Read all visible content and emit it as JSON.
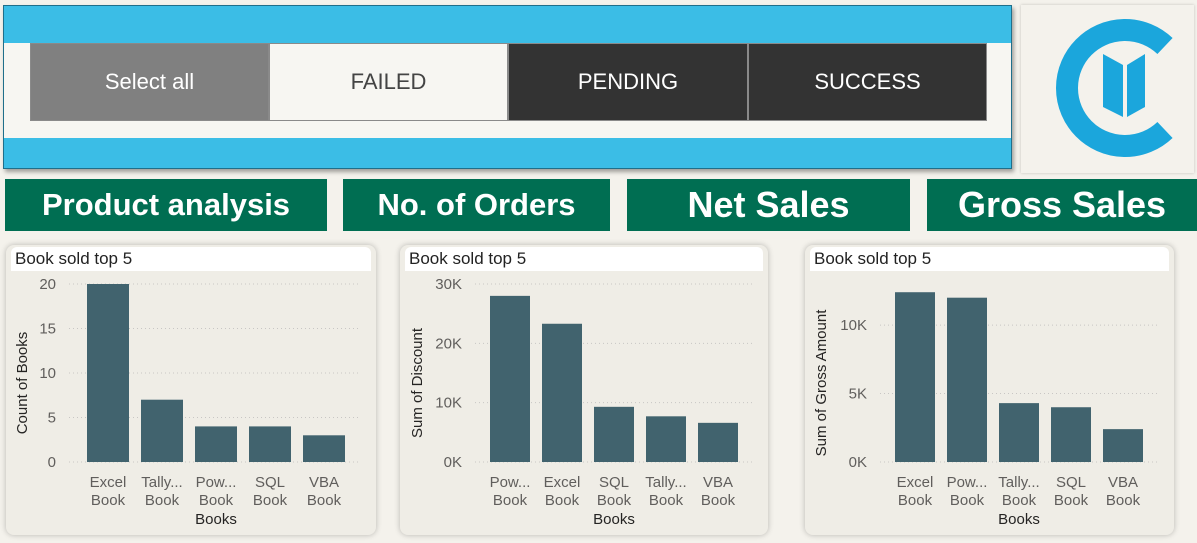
{
  "slicer": {
    "items": [
      {
        "label": "Select all",
        "bg": "#808080",
        "fg": "#ffffff"
      },
      {
        "label": "FAILED",
        "bg": "#f7f6f2",
        "fg": "#444444"
      },
      {
        "label": "PENDING",
        "bg": "#333333",
        "fg": "#ffffff"
      },
      {
        "label": "SUCCESS",
        "bg": "#333333",
        "fg": "#ffffff"
      }
    ]
  },
  "nav": {
    "items": [
      "Product analysis",
      "No. of Orders",
      "Net Sales",
      "Gross Sales"
    ]
  },
  "colors": {
    "accent": "#3bbde6",
    "nav_bg": "#006e52",
    "bar": "#41636e",
    "logo": "#1ba6dc"
  },
  "logo": {
    "icon": "c-book-logo-icon"
  },
  "chart_data": [
    {
      "type": "bar",
      "title": "Book sold top 5",
      "categories": [
        "Excel Book",
        "Tally... Book",
        "Pow... Book",
        "SQL Book",
        "VBA Book"
      ],
      "values": [
        20,
        7,
        4,
        4,
        3
      ],
      "xlabel": "Books",
      "ylabel": "Count of Books",
      "ylim": [
        0,
        20
      ],
      "yticks": [
        0,
        5,
        10,
        15,
        20
      ],
      "ytick_labels": [
        "0",
        "5",
        "10",
        "15",
        "20"
      ],
      "grid": true
    },
    {
      "type": "bar",
      "title": "Book sold top 5",
      "categories": [
        "Pow... Book",
        "Excel Book",
        "SQL Book",
        "Tally... Book",
        "VBA Book"
      ],
      "values": [
        28000,
        23300,
        9300,
        7700,
        6600
      ],
      "xlabel": "Books",
      "ylabel": "Sum of Discount",
      "ylim": [
        0,
        30000
      ],
      "yticks": [
        0,
        10000,
        20000,
        30000
      ],
      "ytick_labels": [
        "0K",
        "10K",
        "20K",
        "30K"
      ],
      "grid": true
    },
    {
      "type": "bar",
      "title": "Book sold top 5",
      "categories": [
        "Excel Book",
        "Pow... Book",
        "Tally... Book",
        "SQL Book",
        "VBA Book"
      ],
      "values": [
        12400,
        12000,
        4300,
        4000,
        2400
      ],
      "xlabel": "Books",
      "ylabel": "Sum of Gross Amount",
      "ylim": [
        0,
        13000
      ],
      "yticks": [
        0,
        5000,
        10000
      ],
      "ytick_labels": [
        "0K",
        "5K",
        "10K"
      ],
      "grid": true
    }
  ]
}
